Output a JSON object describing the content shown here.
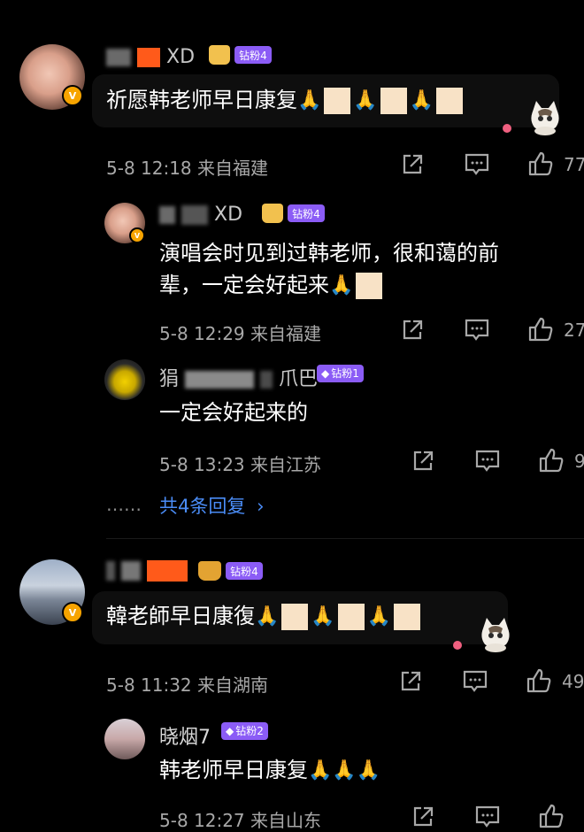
{
  "colors": {
    "background": "#000000",
    "accent_link": "#4a8cf6",
    "verified_badge": "#f7a400",
    "fan_badge": "#8b5cf6",
    "meta_text": "#a8a8a8"
  },
  "comments": [
    {
      "name_visible": "XD",
      "fan_badge": "钻粉4",
      "text": "祈愿韩老师早日康复",
      "meta": "5-8 12:18  来自福建",
      "likes": "77",
      "replies": [
        {
          "name_visible": "XD",
          "fan_badge": "钻粉4",
          "text_line1": "演唱会时见到过韩老师，很和蔼的前",
          "text_line2": "辈，一定会好起来",
          "meta": "5-8 12:29  来自福建",
          "likes": "27"
        },
        {
          "name_prefix": "狷",
          "name_visible": "爪巴",
          "fan_badge": "钻粉1",
          "text": "一定会好起来的",
          "meta": "5-8 13:23  来自江苏",
          "likes": "9"
        }
      ],
      "more_replies": "共4条回复",
      "ellipsis": "……"
    },
    {
      "fan_badge": "钻粉4",
      "text": "韓老師早日康復",
      "meta": "5-8 11:32  来自湖南",
      "likes": "49",
      "replies": [
        {
          "name_visible": "晓烟7",
          "fan_badge": "钻粉2",
          "text": "韩老师早日康复",
          "meta": "5-8 12:27  来自山东",
          "likes": ""
        }
      ]
    }
  ],
  "icons": {
    "share": "share-icon",
    "comment": "comment-icon",
    "like": "thumbs-up-icon",
    "verified": "verified-v-icon",
    "crown": "crown-icon",
    "diamond": "diamond-icon",
    "chevron": "chevron-right-icon"
  }
}
